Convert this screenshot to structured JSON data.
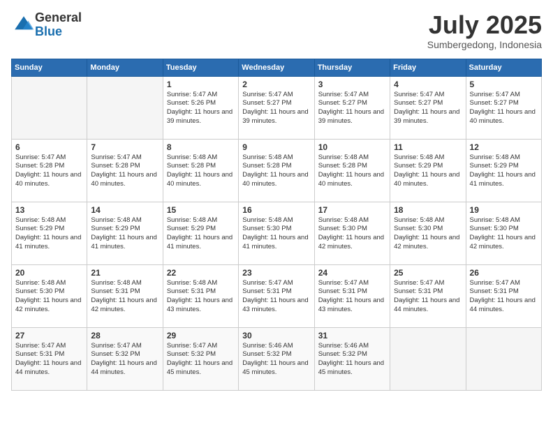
{
  "header": {
    "logo_general": "General",
    "logo_blue": "Blue",
    "month": "July 2025",
    "location": "Sumbergedong, Indonesia"
  },
  "days_of_week": [
    "Sunday",
    "Monday",
    "Tuesday",
    "Wednesday",
    "Thursday",
    "Friday",
    "Saturday"
  ],
  "weeks": [
    [
      {
        "day": "",
        "info": ""
      },
      {
        "day": "",
        "info": ""
      },
      {
        "day": "1",
        "info": "Sunrise: 5:47 AM\nSunset: 5:26 PM\nDaylight: 11 hours and 39 minutes."
      },
      {
        "day": "2",
        "info": "Sunrise: 5:47 AM\nSunset: 5:27 PM\nDaylight: 11 hours and 39 minutes."
      },
      {
        "day": "3",
        "info": "Sunrise: 5:47 AM\nSunset: 5:27 PM\nDaylight: 11 hours and 39 minutes."
      },
      {
        "day": "4",
        "info": "Sunrise: 5:47 AM\nSunset: 5:27 PM\nDaylight: 11 hours and 39 minutes."
      },
      {
        "day": "5",
        "info": "Sunrise: 5:47 AM\nSunset: 5:27 PM\nDaylight: 11 hours and 40 minutes."
      }
    ],
    [
      {
        "day": "6",
        "info": "Sunrise: 5:47 AM\nSunset: 5:28 PM\nDaylight: 11 hours and 40 minutes."
      },
      {
        "day": "7",
        "info": "Sunrise: 5:47 AM\nSunset: 5:28 PM\nDaylight: 11 hours and 40 minutes."
      },
      {
        "day": "8",
        "info": "Sunrise: 5:48 AM\nSunset: 5:28 PM\nDaylight: 11 hours and 40 minutes."
      },
      {
        "day": "9",
        "info": "Sunrise: 5:48 AM\nSunset: 5:28 PM\nDaylight: 11 hours and 40 minutes."
      },
      {
        "day": "10",
        "info": "Sunrise: 5:48 AM\nSunset: 5:28 PM\nDaylight: 11 hours and 40 minutes."
      },
      {
        "day": "11",
        "info": "Sunrise: 5:48 AM\nSunset: 5:29 PM\nDaylight: 11 hours and 40 minutes."
      },
      {
        "day": "12",
        "info": "Sunrise: 5:48 AM\nSunset: 5:29 PM\nDaylight: 11 hours and 41 minutes."
      }
    ],
    [
      {
        "day": "13",
        "info": "Sunrise: 5:48 AM\nSunset: 5:29 PM\nDaylight: 11 hours and 41 minutes."
      },
      {
        "day": "14",
        "info": "Sunrise: 5:48 AM\nSunset: 5:29 PM\nDaylight: 11 hours and 41 minutes."
      },
      {
        "day": "15",
        "info": "Sunrise: 5:48 AM\nSunset: 5:29 PM\nDaylight: 11 hours and 41 minutes."
      },
      {
        "day": "16",
        "info": "Sunrise: 5:48 AM\nSunset: 5:30 PM\nDaylight: 11 hours and 41 minutes."
      },
      {
        "day": "17",
        "info": "Sunrise: 5:48 AM\nSunset: 5:30 PM\nDaylight: 11 hours and 42 minutes."
      },
      {
        "day": "18",
        "info": "Sunrise: 5:48 AM\nSunset: 5:30 PM\nDaylight: 11 hours and 42 minutes."
      },
      {
        "day": "19",
        "info": "Sunrise: 5:48 AM\nSunset: 5:30 PM\nDaylight: 11 hours and 42 minutes."
      }
    ],
    [
      {
        "day": "20",
        "info": "Sunrise: 5:48 AM\nSunset: 5:30 PM\nDaylight: 11 hours and 42 minutes."
      },
      {
        "day": "21",
        "info": "Sunrise: 5:48 AM\nSunset: 5:31 PM\nDaylight: 11 hours and 42 minutes."
      },
      {
        "day": "22",
        "info": "Sunrise: 5:48 AM\nSunset: 5:31 PM\nDaylight: 11 hours and 43 minutes."
      },
      {
        "day": "23",
        "info": "Sunrise: 5:47 AM\nSunset: 5:31 PM\nDaylight: 11 hours and 43 minutes."
      },
      {
        "day": "24",
        "info": "Sunrise: 5:47 AM\nSunset: 5:31 PM\nDaylight: 11 hours and 43 minutes."
      },
      {
        "day": "25",
        "info": "Sunrise: 5:47 AM\nSunset: 5:31 PM\nDaylight: 11 hours and 44 minutes."
      },
      {
        "day": "26",
        "info": "Sunrise: 5:47 AM\nSunset: 5:31 PM\nDaylight: 11 hours and 44 minutes."
      }
    ],
    [
      {
        "day": "27",
        "info": "Sunrise: 5:47 AM\nSunset: 5:31 PM\nDaylight: 11 hours and 44 minutes."
      },
      {
        "day": "28",
        "info": "Sunrise: 5:47 AM\nSunset: 5:32 PM\nDaylight: 11 hours and 44 minutes."
      },
      {
        "day": "29",
        "info": "Sunrise: 5:47 AM\nSunset: 5:32 PM\nDaylight: 11 hours and 45 minutes."
      },
      {
        "day": "30",
        "info": "Sunrise: 5:46 AM\nSunset: 5:32 PM\nDaylight: 11 hours and 45 minutes."
      },
      {
        "day": "31",
        "info": "Sunrise: 5:46 AM\nSunset: 5:32 PM\nDaylight: 11 hours and 45 minutes."
      },
      {
        "day": "",
        "info": ""
      },
      {
        "day": "",
        "info": ""
      }
    ]
  ]
}
